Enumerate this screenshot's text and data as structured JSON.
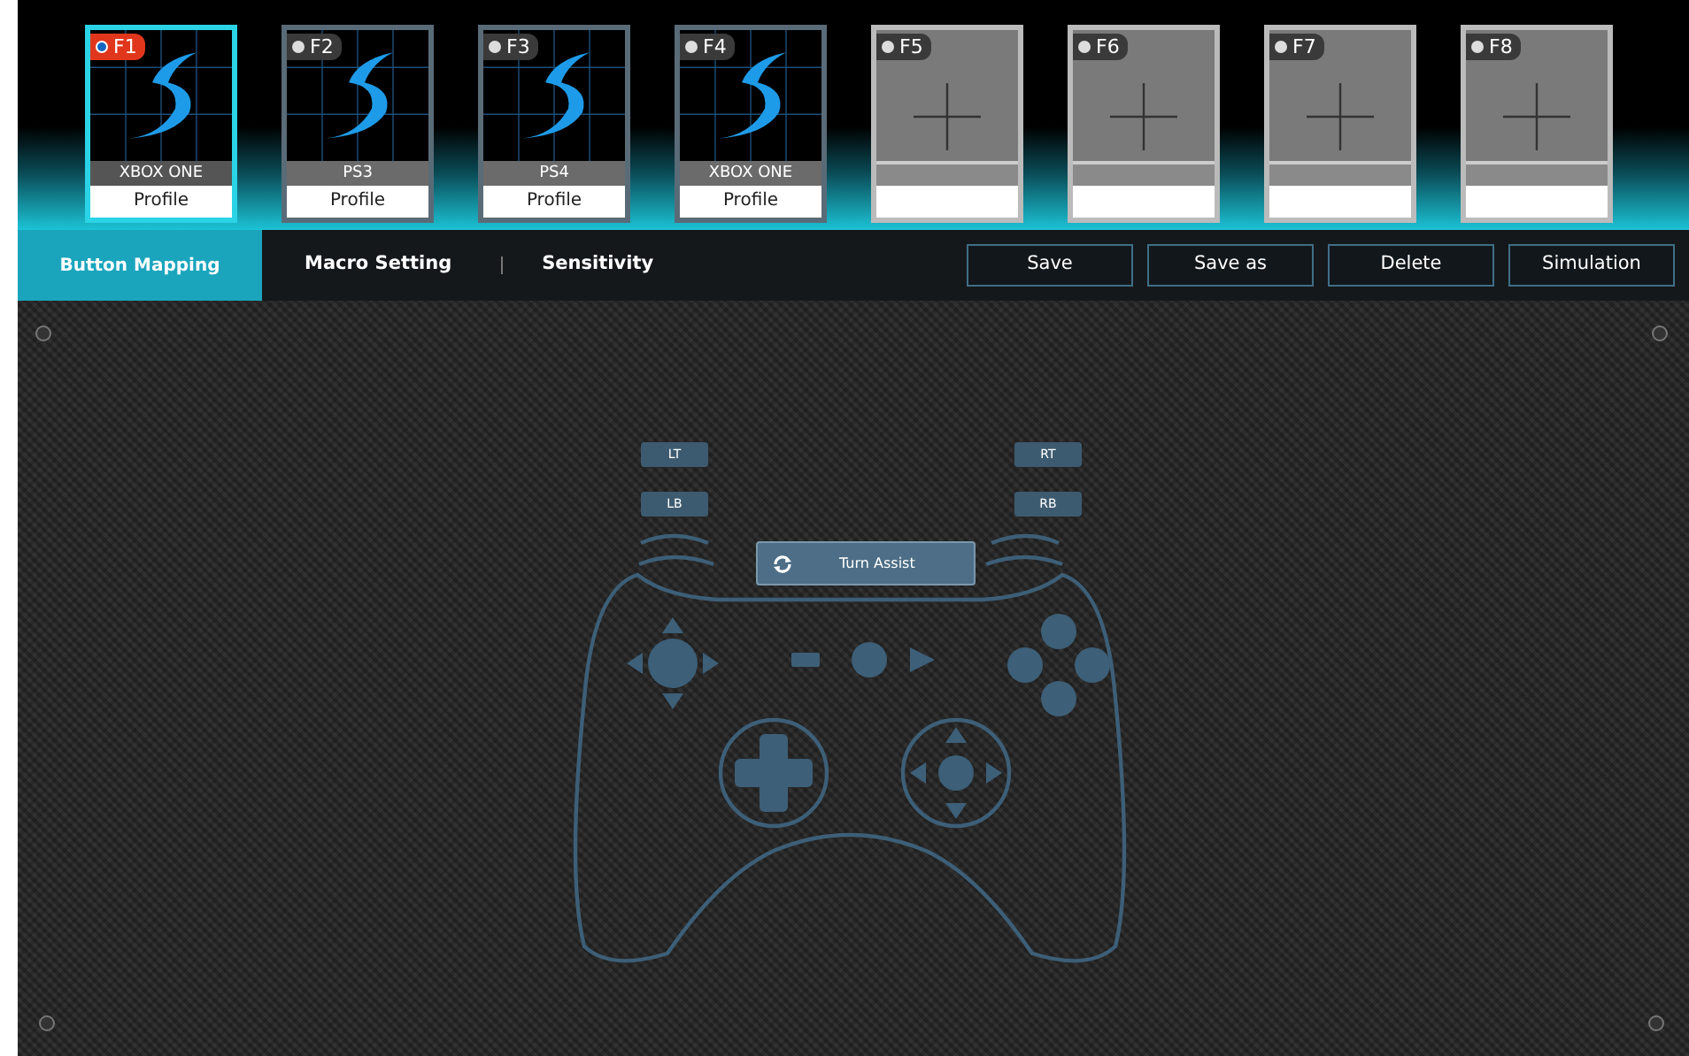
{
  "profiles": [
    {
      "key": "F1",
      "kind": "set",
      "selected": true,
      "platform": "XBOX ONE",
      "label": "Profile"
    },
    {
      "key": "F2",
      "kind": "set",
      "selected": false,
      "platform": "PS3",
      "label": "Profile"
    },
    {
      "key": "F3",
      "kind": "set",
      "selected": false,
      "platform": "PS4",
      "label": "Profile"
    },
    {
      "key": "F4",
      "kind": "set",
      "selected": false,
      "platform": "XBOX ONE",
      "label": "Profile"
    },
    {
      "key": "F5",
      "kind": "empty",
      "selected": false
    },
    {
      "key": "F6",
      "kind": "empty",
      "selected": false
    },
    {
      "key": "F7",
      "kind": "empty",
      "selected": false
    },
    {
      "key": "F8",
      "kind": "empty",
      "selected": false
    }
  ],
  "tabs": [
    {
      "label": "Button Mapping",
      "selected": true
    },
    {
      "label": "Macro Setting",
      "selected": false
    },
    {
      "label": "Sensitivity",
      "selected": false
    }
  ],
  "actions": [
    "Save",
    "Save as",
    "Delete",
    "Simulation"
  ],
  "controller": {
    "triggers": [
      "LT",
      "LB",
      "RT",
      "RB"
    ],
    "assist_button": "Turn Assist"
  }
}
